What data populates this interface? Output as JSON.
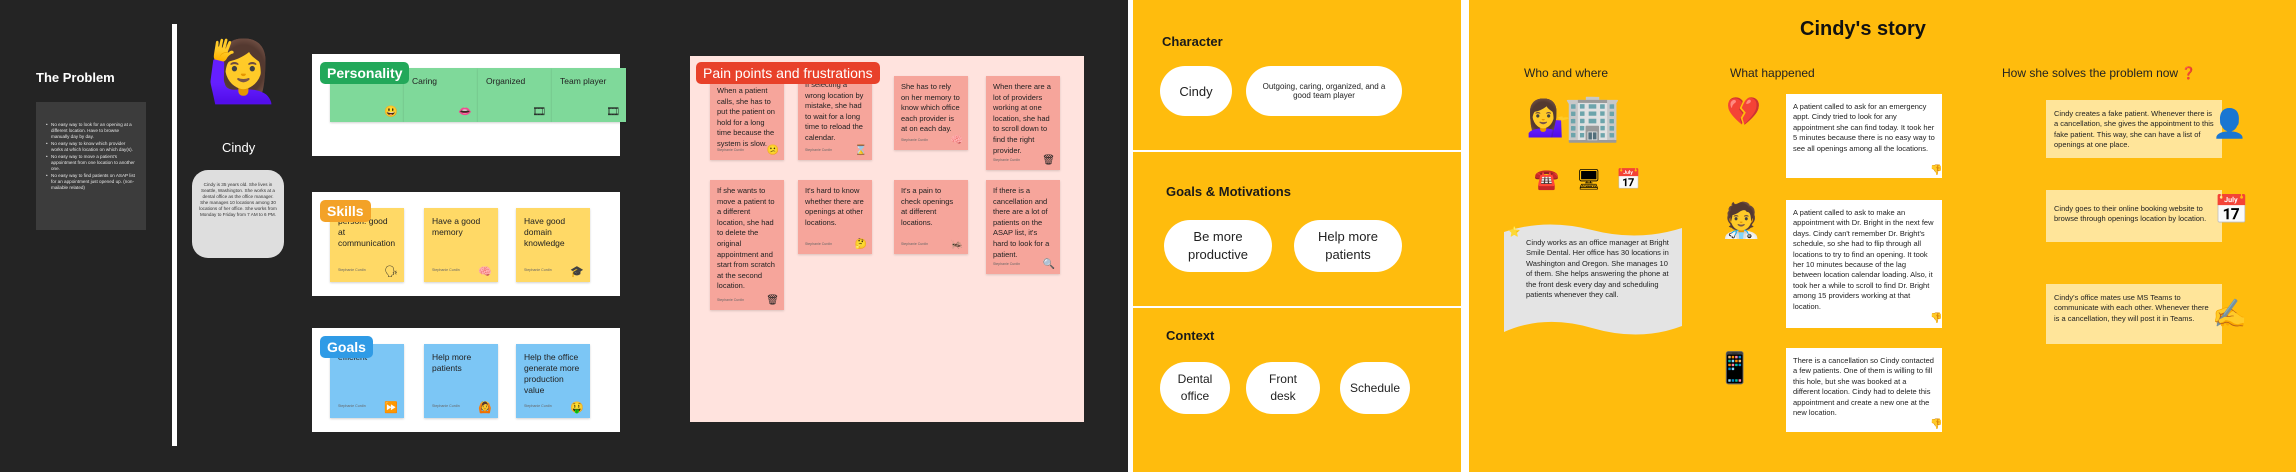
{
  "left_board": {
    "problem": {
      "title": "The Problem",
      "bullets": [
        "No easy way to look for an opening at a different location. Have to browse manually day by day.",
        "No easy way to know which provider works at which location on which day(s).",
        "No easy way to move a patient's appointment from one location to another one.",
        "No easy way to find patients on ASAP list for an appointment just opened up. (non-mailable related)"
      ]
    },
    "persona": {
      "name": "Cindy",
      "bio": "Cindy is 35 years old. She lives in Seattle, Washington. She works at a dental office as the office manager. She manages 10 locations among 30 locations of her office. She works from Monday to Friday from 7 AM to 6 PM."
    },
    "personality": {
      "tag": "Personality",
      "notes": [
        {
          "text": "",
          "emoji": "😃"
        },
        {
          "text": "Caring",
          "emoji": "👄"
        },
        {
          "text": "Organized",
          "emoji": "🎞"
        },
        {
          "text": "Team player",
          "emoji": "🎞"
        }
      ]
    },
    "skills": {
      "tag": "Skills",
      "notes": [
        {
          "text": "person: good at communication",
          "emoji": "🗣"
        },
        {
          "text": "Have a good memory",
          "emoji": "🧠"
        },
        {
          "text": "Have good domain knowledge",
          "emoji": "🎓"
        }
      ]
    },
    "goals": {
      "tag": "Goals",
      "notes": [
        {
          "text": "efficient",
          "emoji": "⏩"
        },
        {
          "text": "Help more patients",
          "emoji": "🙆"
        },
        {
          "text": "Help the office generate more production value",
          "emoji": "🤑"
        }
      ]
    },
    "meta_label": "Stephanie Curdin",
    "pain_points": {
      "tag": "Pain points and frustrations",
      "notes": [
        {
          "text": "When a patient calls, she has to put the patient on hold for a long time because the system is slow.",
          "emoji": "😕"
        },
        {
          "text": "If selecting a wrong location by mistake, she had to wait for a long time to reload the calendar.",
          "emoji": "⌛"
        },
        {
          "text": "She has to rely on her memory to know which office each provider is at on each day.",
          "emoji": "🧠"
        },
        {
          "text": "When there are a lot of providers working at one location, she had to scroll down to find the right provider.",
          "emoji": "🗑"
        },
        {
          "text": "If she wants to move a patient to a different location, she had to delete the original appointment and start from scratch at the second location.",
          "emoji": "🗑"
        },
        {
          "text": "It's hard to know whether there are openings at other locations.",
          "emoji": "🤔"
        },
        {
          "text": "It's a pain to check openings at different locations.",
          "emoji": "🦗"
        },
        {
          "text": "If there is a cancellation and there are a lot of patients on the ASAP list, it's hard to look for a patient.",
          "emoji": "🔍"
        }
      ]
    }
  },
  "middle_board": {
    "character": {
      "title": "Character",
      "name": "Cindy",
      "traits": "Outgoing, caring, organized, and a good team player"
    },
    "goals": {
      "title": "Goals & Motivations",
      "items": [
        "Be more productive",
        "Help more patients"
      ]
    },
    "context": {
      "title": "Context",
      "items": [
        "Dental office",
        "Front desk",
        "Schedule"
      ]
    }
  },
  "story": {
    "title": "Cindy's story",
    "col_who": "Who and where",
    "col_what": "What happened",
    "col_how": "How she solves the problem now ❓",
    "who_text": "Cindy works as an office manager at Bright Smile Dental. Her office has 30 locations in Washington and Oregon. She manages 10 of them. She helps answering the phone at the front desk every day and scheduling patients whenever they call.",
    "what": [
      "A patient called to ask for an emergency appt. Cindy tried to look for any appointment she can find today. It took her 5 minutes because there is no easy way to see all openings among all the locations.",
      "A patient called to ask to make an appointment with Dr. Bright in the next few days. Cindy can't remember Dr. Bright's schedule, so she had to flip through all locations to try to find an opening. It took her 10 minutes because of the lag between location calendar loading. Also, it took her a while to scroll to find Dr. Bright among 15 providers working at that location.",
      "There is a cancellation so Cindy contacted a few patients. One of them is willing to fill this hole, but she was booked at a different location. Cindy had to delete this appointment and create a new one at the new location."
    ],
    "how": [
      "Cindy creates a fake patient. Whenever there is a cancellation, she gives the appointment to this fake patient. This way, she can have a list of openings at one place.",
      "Cindy goes to their online booking website to browse through openings location by location.",
      "Cindy's office mates use MS Teams to communicate with each other. Whenever there is a cancellation, they will post it in Teams."
    ],
    "emojis": {
      "who_person": "💁‍♀️",
      "who_building": "🏢",
      "who_phone": "☎️",
      "who_computer": "🖥",
      "who_calendar": "📅",
      "what_1": "💔",
      "what_2": "🧑‍⚕️",
      "what_3": "📱",
      "how_1": "👤",
      "how_2": "📅",
      "how_3": "✍️",
      "thumb": "👎",
      "star": "⭐"
    }
  },
  "colors": {
    "dark_bg": "#242424",
    "yellow_bg": "#ffbc0d",
    "tag_green": "#22a85a",
    "tag_orange": "#f3a227",
    "tag_blue": "#2f9be6",
    "tag_red": "#e8412a"
  }
}
